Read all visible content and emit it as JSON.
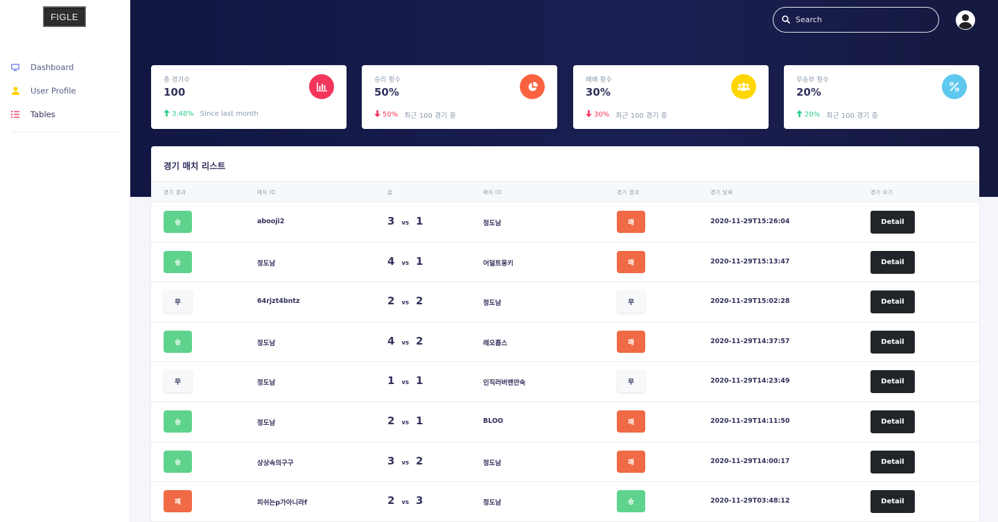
{
  "app": {
    "logo_text": "FIGLE"
  },
  "sidebar": {
    "items": [
      {
        "label": "Dashboard",
        "icon": "monitor-icon",
        "color": "#5e72e4"
      },
      {
        "label": "User Profile",
        "icon": "user-icon",
        "color": "#ffd600"
      },
      {
        "label": "Tables",
        "icon": "list-icon",
        "color": "#f5365c"
      }
    ]
  },
  "header": {
    "search_placeholder": "Search"
  },
  "stats": [
    {
      "title": "총 경기수",
      "value": "100",
      "delta": "3.48%",
      "direction": "up",
      "note": "Since last month",
      "icon": "bar-chart-icon",
      "icon_color": "#f5365c"
    },
    {
      "title": "승리 횟수",
      "value": "50%",
      "delta": "50%",
      "direction": "down",
      "note": "최근 100 경기 중",
      "icon": "pie-chart-icon",
      "icon_color": "#fb6340"
    },
    {
      "title": "패배 횟수",
      "value": "30%",
      "delta": "30%",
      "direction": "down",
      "note": "최근 100 경기 중",
      "icon": "users-icon",
      "icon_color": "#ffd600"
    },
    {
      "title": "무승부 횟수",
      "value": "20%",
      "delta": "20%",
      "direction": "up",
      "note": "최근 100 경기 중",
      "icon": "percent-icon",
      "icon_color": "#5fc8ef"
    }
  ],
  "table": {
    "title": "경기 매치 리스트",
    "headers": [
      "경기 결과",
      "매치 ID",
      "골",
      "매치 ID",
      "경기 결과",
      "경기 날짜",
      "경기 보기"
    ],
    "vs_label": "vs",
    "detail_label": "Detail",
    "rows": [
      {
        "result1": "승",
        "type1": "win",
        "id1": "abooji2",
        "g1": "3",
        "g2": "1",
        "id2": "정도남",
        "result2": "패",
        "type2": "lose",
        "date": "2020-11-29T15:26:04"
      },
      {
        "result1": "승",
        "type1": "win",
        "id1": "정도남",
        "g1": "4",
        "g2": "1",
        "id2": "어덜트몽키",
        "result2": "패",
        "type2": "lose",
        "date": "2020-11-29T15:13:47"
      },
      {
        "result1": "무",
        "type1": "draw",
        "id1": "64rjzt4bntz",
        "g1": "2",
        "g2": "2",
        "id2": "정도남",
        "result2": "무",
        "type2": "draw",
        "date": "2020-11-29T15:02:28"
      },
      {
        "result1": "승",
        "type1": "win",
        "id1": "정도남",
        "g1": "4",
        "g2": "2",
        "id2": "레오홉스",
        "result2": "패",
        "type2": "lose",
        "date": "2020-11-29T14:37:57"
      },
      {
        "result1": "무",
        "type1": "draw",
        "id1": "정도남",
        "g1": "1",
        "g2": "1",
        "id2": "인직러버맨안숙",
        "result2": "무",
        "type2": "draw",
        "date": "2020-11-29T14:23:49"
      },
      {
        "result1": "승",
        "type1": "win",
        "id1": "정도남",
        "g1": "2",
        "g2": "1",
        "id2": "BLOO",
        "result2": "패",
        "type2": "lose",
        "date": "2020-11-29T14:11:50"
      },
      {
        "result1": "승",
        "type1": "win",
        "id1": "상상속의구구",
        "g1": "3",
        "g2": "2",
        "id2": "정도남",
        "result2": "패",
        "type2": "lose",
        "date": "2020-11-29T14:00:17"
      },
      {
        "result1": "패",
        "type1": "lose",
        "id1": "피쉬는p가아니라f",
        "g1": "2",
        "g2": "3",
        "id2": "정도남",
        "result2": "승",
        "type2": "win",
        "date": "2020-11-29T03:48:12"
      }
    ]
  }
}
